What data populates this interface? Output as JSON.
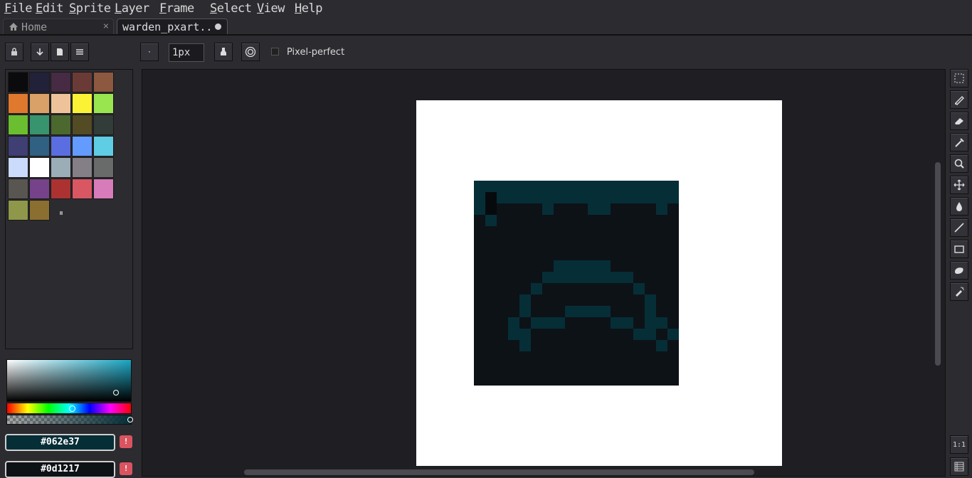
{
  "menu": [
    "File",
    "Edit",
    "Sprite",
    "Layer",
    "Frame",
    "Select",
    "View",
    "Help"
  ],
  "tabs": {
    "home": {
      "label": "Home",
      "close": "×"
    },
    "file": {
      "label": "warden_pxart.."
    }
  },
  "toolbar": {
    "brush_size": "1px",
    "pixel_perfect_label": "Pixel-perfect",
    "pixel_perfect_checked": false
  },
  "palette": {
    "colors": [
      "#0b0b0d",
      "#22213a",
      "#472a44",
      "#6a3b36",
      "#8c5840",
      "#e0782e",
      "#d9a068",
      "#eec39a",
      "#fbf236",
      "#99e550",
      "#6abe30",
      "#37946e",
      "#4b692f",
      "#524b24",
      "#323c39",
      "#3f3f74",
      "#306082",
      "#5b6ee1",
      "#639bff",
      "#5fcde4",
      "#cbdbfc",
      "#ffffff",
      "#9badb7",
      "#847e87",
      "#696a6a",
      "#595652",
      "#76428a",
      "#ac3232",
      "#d95763",
      "#d77bba",
      "#8f974a",
      "#8a6f30"
    ],
    "handle": "⏸"
  },
  "color_fields": [
    {
      "hex": "#062e37",
      "warn": "!"
    },
    {
      "hex": "#0d1217",
      "warn": "!"
    }
  ],
  "sprite": {
    "colors": {
      "bg": "#0d1217",
      "fg": "#062e37",
      "dark": "#070a0d"
    },
    "rows": [
      "AAAAAAAAAAAAAAAAAA",
      "ADAAAAAAAAAAAAAAAA",
      "ADBBBBABBBAABBBBAB",
      "BABBBBBBBBBBBBBBBB",
      "BBBBBBBBBBBBBBBBBB",
      "BBBBBBBBBBBBBBBBBB",
      "BBBBBBBBBBBBBBBBBB",
      "BBBBBBBAAAAABBBBBB",
      "BBBBBBAAAAAAAABBBB",
      "BBBBBABBBBBBBBABBB",
      "BBBBABBBBBBBBBBABB",
      "BBBBABBBAAAABBBABB",
      "BBBABAAABBBBAABAAB",
      "BBBAABBBBBBBBBAABA",
      "BBBBABBBBBBBBBBBAB",
      "BBBBBBBBBBBBBBBBBB",
      "BBBBBBBBBBBBBBBBBB",
      "BBBBBBBBBBBBBBBBBB"
    ]
  },
  "tools": [
    "rect-select-icon",
    "pencil-icon",
    "eraser-icon",
    "eyedropper-icon",
    "zoom-icon",
    "move-icon",
    "paint-bucket-icon",
    "line-icon",
    "rectangle-icon",
    "contour-icon",
    "spray-icon"
  ],
  "bottom_tools": {
    "zoom_label": "1:1"
  }
}
